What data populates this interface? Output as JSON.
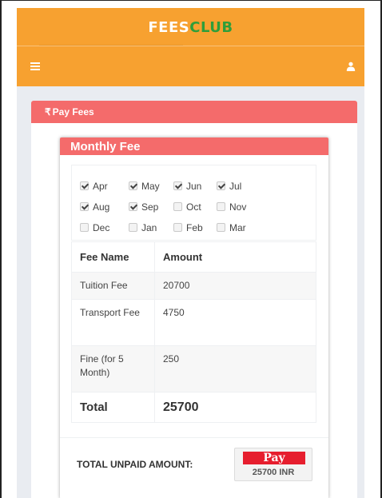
{
  "brand": {
    "part1": "FEES",
    "part2": "CLUB"
  },
  "nav": {
    "menu_icon": "hamburger-menu-icon",
    "user_icon": "user-icon"
  },
  "colors": {
    "brand_orange": "#f7a130",
    "header_red": "#f46b6b",
    "brand_green": "#2f9e3a",
    "pay_red": "#e61e2e"
  },
  "card": {
    "rupee": "₹",
    "title": "Pay Fees"
  },
  "monthly": {
    "title": "Monthly Fee",
    "months": [
      {
        "label": "Apr",
        "checked": true
      },
      {
        "label": "May",
        "checked": true
      },
      {
        "label": "Jun",
        "checked": true
      },
      {
        "label": "Jul",
        "checked": true
      },
      {
        "label": "Aug",
        "checked": true
      },
      {
        "label": "Sep",
        "checked": true
      },
      {
        "label": "Oct",
        "checked": false
      },
      {
        "label": "Nov",
        "checked": false
      },
      {
        "label": "Dec",
        "checked": false
      },
      {
        "label": "Jan",
        "checked": false
      },
      {
        "label": "Feb",
        "checked": false
      },
      {
        "label": "Mar",
        "checked": false
      }
    ]
  },
  "table": {
    "headers": [
      "Fee Name",
      "Amount"
    ],
    "rows": [
      {
        "name": "Tuition Fee",
        "amount": "20700"
      },
      {
        "name": "Transport Fee",
        "amount": "4750"
      },
      {
        "name": "Fine (for 5 Month)",
        "amount": "250"
      }
    ],
    "total_label": "Total",
    "total_amount": "25700"
  },
  "footer": {
    "unpaid_label": "TOTAL UNPAID AMOUNT:",
    "pay_label": "Pay",
    "pay_amount": "25700 INR"
  }
}
